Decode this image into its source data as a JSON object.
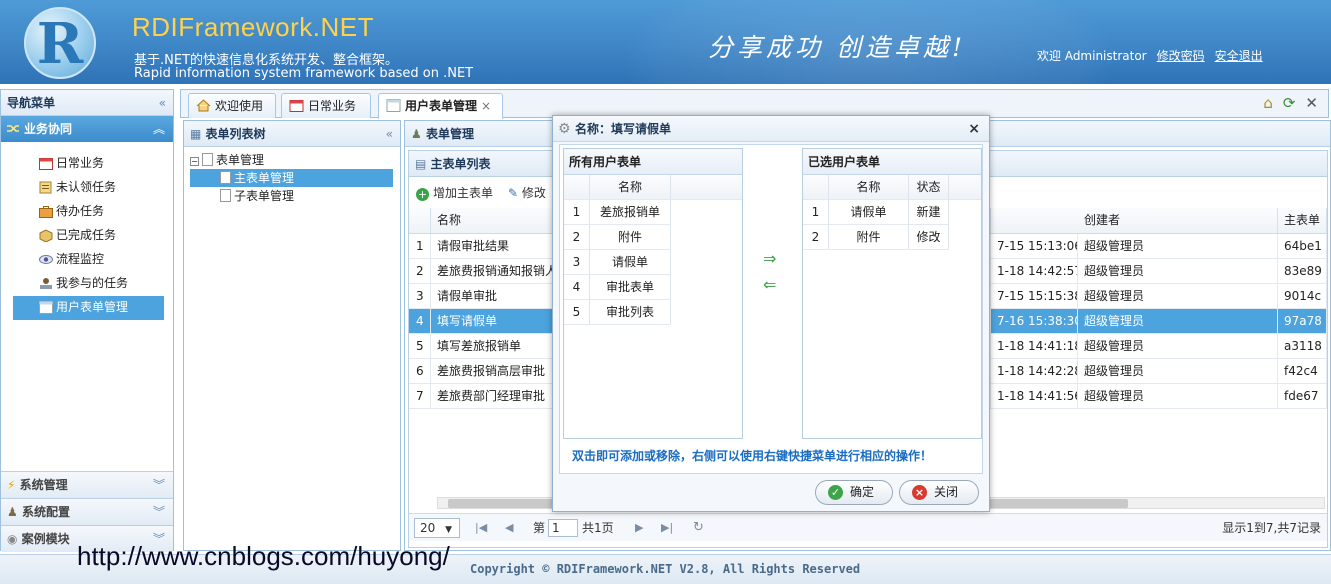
{
  "header": {
    "logo_letter": "R",
    "title": "RDIFramework.NET",
    "subtitle_cn": "基于.NET的快速信息化系统开发、整合框架。",
    "subtitle_en": "Rapid information system framework based on .NET",
    "slogan": "分享成功  创造卓越!",
    "welcome": "欢迎 Administrator",
    "change_password": "修改密码",
    "logout": "安全退出"
  },
  "leftnav": {
    "title": "导航菜单",
    "collapse": "«",
    "active_section": "业务协同",
    "items": [
      {
        "label": "日常业务"
      },
      {
        "label": "未认领任务"
      },
      {
        "label": "待办任务"
      },
      {
        "label": "已完成任务"
      },
      {
        "label": "流程监控"
      },
      {
        "label": "我参与的任务"
      },
      {
        "label": "用户表单管理"
      }
    ],
    "sections": [
      {
        "label": "系统管理"
      },
      {
        "label": "系统配置"
      },
      {
        "label": "案例模块"
      }
    ]
  },
  "tabs": [
    {
      "label": "欢迎使用"
    },
    {
      "label": "日常业务"
    },
    {
      "label": "用户表单管理"
    }
  ],
  "tree_panel": {
    "title": "表单列表树",
    "root": "表单管理",
    "children": [
      "主表单管理",
      "子表单管理"
    ]
  },
  "main_panel": {
    "title": "表单管理",
    "subtitle": "主表单列表",
    "add_button": "增加主表单",
    "edit_button": "修改",
    "columns": {
      "name": "名称",
      "creator": "创建者",
      "main_table": "主表单"
    },
    "rows": [
      {
        "no": "1",
        "name": "请假审批结果",
        "time": "7-15 15:13:06",
        "creator": "超级管理员",
        "id": "64be1"
      },
      {
        "no": "2",
        "name": "差旅费报销通知报销人",
        "time": "1-18 14:42:57",
        "creator": "超级管理员",
        "id": "83e89"
      },
      {
        "no": "3",
        "name": "请假单审批",
        "time": "7-15 15:15:38",
        "creator": "超级管理员",
        "id": "9014c"
      },
      {
        "no": "4",
        "name": "填写请假单",
        "time": "7-16 15:38:30",
        "creator": "超级管理员",
        "id": "97a78"
      },
      {
        "no": "5",
        "name": "填写差旅报销单",
        "time": "1-18 14:41:18",
        "creator": "超级管理员",
        "id": "a3118"
      },
      {
        "no": "6",
        "name": "差旅费报销高层审批",
        "time": "1-18 14:42:28",
        "creator": "超级管理员",
        "id": "f42c4"
      },
      {
        "no": "7",
        "name": "差旅费部门经理审批",
        "time": "1-18 14:41:56",
        "creator": "超级管理员",
        "id": "fde67"
      }
    ],
    "selected_row": 4,
    "pager": {
      "page_size": "20",
      "page_label_pre": "第",
      "page_value": "1",
      "page_label_post": "共1页",
      "summary": "显示1到7,共7记录"
    }
  },
  "dialog": {
    "title": "名称：填写请假单",
    "left_title": "所有用户表单",
    "right_title": "已选用户表单",
    "col_name": "名称",
    "col_status": "状态",
    "all_forms": [
      {
        "no": "1",
        "name": "差旅报销单"
      },
      {
        "no": "2",
        "name": "附件"
      },
      {
        "no": "3",
        "name": "请假单"
      },
      {
        "no": "4",
        "name": "审批表单"
      },
      {
        "no": "5",
        "name": "审批列表"
      }
    ],
    "selected_forms": [
      {
        "no": "1",
        "name": "请假单",
        "status": "新建"
      },
      {
        "no": "2",
        "name": "附件",
        "status": "修改"
      }
    ],
    "add_arrow": "⇒",
    "remove_arrow": "⇐",
    "hint": "双击即可添加或移除，右侧可以使用右键快捷菜单进行相应的操作！",
    "ok_button": "确定",
    "close_button": "关闭"
  },
  "footer": {
    "copyright": "Copyright © RDIFramework.NET V2.8, All Rights Reserved"
  },
  "watermark": "http://www.cnblogs.com/huyong/"
}
